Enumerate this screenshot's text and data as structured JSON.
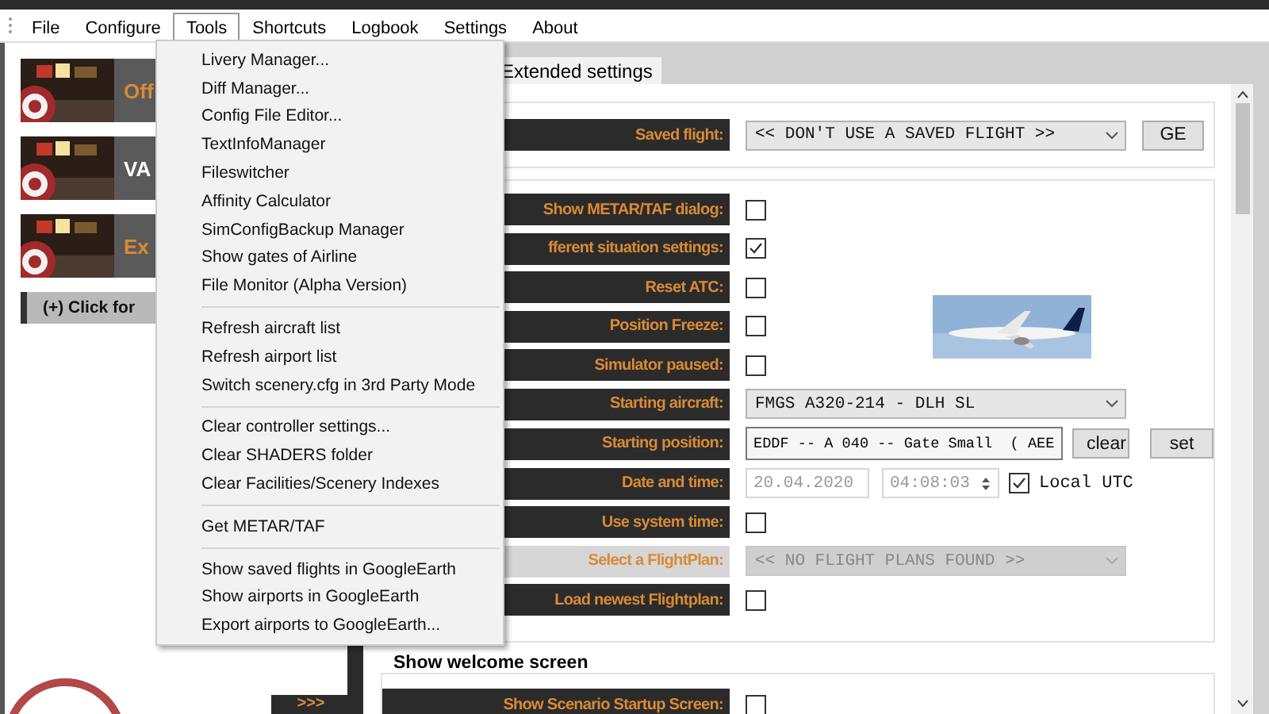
{
  "menu_bar": [
    {
      "label": "File",
      "selected": false
    },
    {
      "label": "Configure",
      "selected": false
    },
    {
      "label": "Tools",
      "selected": true
    },
    {
      "label": "Shortcuts",
      "selected": false
    },
    {
      "label": "Logbook",
      "selected": false
    },
    {
      "label": "Settings",
      "selected": false
    },
    {
      "label": "About",
      "selected": false
    }
  ],
  "tools_menu": [
    [
      "Livery Manager...",
      "Diff Manager...",
      "Config File Editor...",
      "TextInfoManager",
      "Fileswitcher",
      "Affinity Calculator",
      "SimConfigBackup Manager",
      "Show gates of Airline",
      "File Monitor (Alpha Version)"
    ],
    [
      "Refresh aircraft list",
      "Refresh airport list",
      "Switch scenery.cfg in 3rd Party Mode"
    ],
    [
      "Clear controller settings...",
      "Clear SHADERS folder",
      "Clear Facilities/Scenery Indexes"
    ],
    [
      "Get METAR/TAF"
    ],
    [
      "Show saved flights in GoogleEarth",
      "Show airports in GoogleEarth",
      "Export airports to GoogleEarth..."
    ]
  ],
  "left_panel": {
    "banners": [
      {
        "label": "Off",
        "color": "#d98a35"
      },
      {
        "label": "VA",
        "color": "#ffffff"
      },
      {
        "label": "Ex",
        "color": "#d98a35"
      }
    ],
    "expand_button": "(+) Click for",
    "more_button": ">>>"
  },
  "tabs": [
    {
      "label": "Extended settings",
      "selected": true
    }
  ],
  "saved_flight": {
    "label": "Saved flight:",
    "value": "<< DON'T USE A SAVED FLIGHT >>",
    "button": "GE"
  },
  "settings": [
    {
      "kind": "checkbox",
      "label": "Show METAR/TAF dialog:",
      "checked": false
    },
    {
      "kind": "checkbox",
      "label": "fferent situation settings:",
      "checked": true
    },
    {
      "kind": "checkbox",
      "label": "Reset ATC:",
      "checked": false
    },
    {
      "kind": "checkbox",
      "label": "Position Freeze:",
      "checked": false
    },
    {
      "kind": "checkbox",
      "label": "Simulator paused:",
      "checked": false
    },
    {
      "kind": "select",
      "label": "Starting aircraft:",
      "value": "FMGS A320-214 - DLH SL",
      "disabled": false
    },
    {
      "kind": "position",
      "label": "Starting position:",
      "value": "EDDF -- A 040 -- Gate Small  ( AEE",
      "buttons": [
        "clear",
        "set"
      ]
    },
    {
      "kind": "datetime",
      "label": "Date and time:",
      "date": "20.04.2020",
      "time": "04:08:03",
      "utc_label": "Local UTC",
      "utc_checked": true
    },
    {
      "kind": "checkbox",
      "label": "Use system time:",
      "checked": false
    },
    {
      "kind": "select",
      "label": "Select a FlightPlan:",
      "value": "<< NO FLIGHT PLANS FOUND >>",
      "disabled": true
    },
    {
      "kind": "checkbox",
      "label": "Load newest Flightplan:",
      "checked": false
    }
  ],
  "welcome": {
    "title": "Show welcome screen",
    "settings": [
      {
        "kind": "checkbox",
        "label": "Show Scenario Startup Screen:",
        "checked": false
      }
    ]
  }
}
